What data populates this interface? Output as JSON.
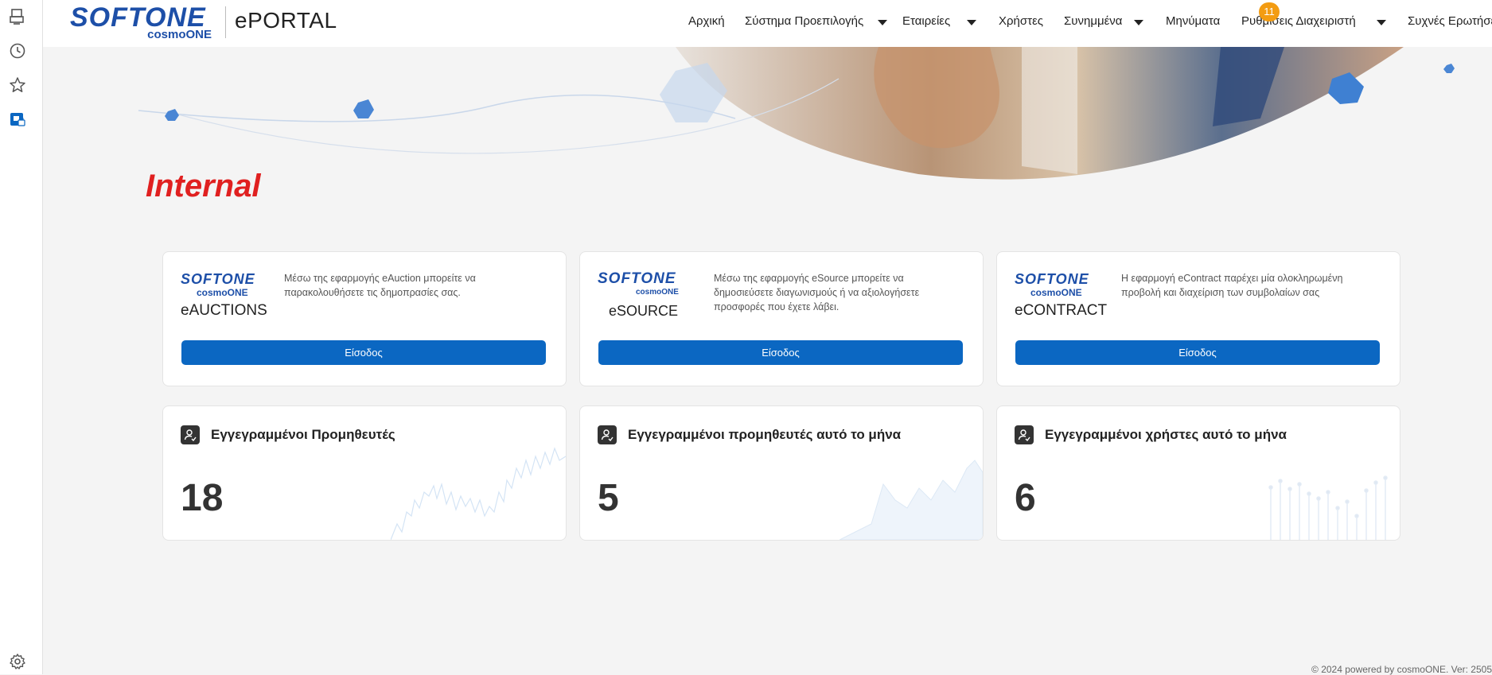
{
  "header": {
    "logo_main": "SOFTONE",
    "logo_sub": "cosmoONE",
    "portal_title": "ePORTAL",
    "nav": [
      {
        "label": "Αρχική",
        "dropdown": false
      },
      {
        "label": "Σύστημα Προεπιλογής",
        "dropdown": true
      },
      {
        "label": "Εταιρείες",
        "dropdown": true
      },
      {
        "label": "Χρήστες",
        "dropdown": false
      },
      {
        "label": "Συνημμένα",
        "dropdown": true
      },
      {
        "label": "Μηνύματα",
        "dropdown": false
      },
      {
        "label": "Ρυθμίσεις Διαχειριστή",
        "dropdown": true
      },
      {
        "label": "Συχνές Ερωτήσεις",
        "dropdown": false
      }
    ],
    "messages_badge": "11"
  },
  "page": {
    "heading": "Internal"
  },
  "apps": [
    {
      "brand": "SOFTONE",
      "sub": "cosmoONE",
      "product": "eAUCTIONS",
      "description": "Μέσω της εφαρμογής eAuction μπορείτε να παρακολουθήσετε τις δημοπρασίες σας.",
      "button": "Είσοδος"
    },
    {
      "brand": "SOFTONE",
      "sub": "cosmoONE",
      "product": "eSOURCE",
      "description": "Μέσω της εφαρμογής eSource μπορείτε να δημοσιεύσετε διαγωνισμούς ή να αξιολογήσετε προσφορές που έχετε λάβει.",
      "button": "Είσοδος"
    },
    {
      "brand": "SOFTONE",
      "sub": "cosmoONE",
      "product": "eCONTRACT",
      "description": "Η εφαρμογή eContract παρέχει μία ολοκληρωμένη προβολή και διαχείριση των συμβολαίων σας",
      "button": "Είσοδος"
    }
  ],
  "stats": [
    {
      "title": "Εγγεγραμμένοι Προμηθευτές",
      "value": "18"
    },
    {
      "title": "Εγγεγραμμένοι προμηθευτές αυτό το μήνα",
      "value": "5"
    },
    {
      "title": "Εγγεγραμμένοι χρήστες αυτό το μήνα",
      "value": "6"
    }
  ],
  "footer": {
    "text": "© 2024 powered by cosmoONE. Ver: 2505"
  },
  "colors": {
    "brand_blue": "#1d4fa8",
    "button_blue": "#0b67c2",
    "heading_red": "#e02020",
    "badge_orange": "#f39c12"
  }
}
